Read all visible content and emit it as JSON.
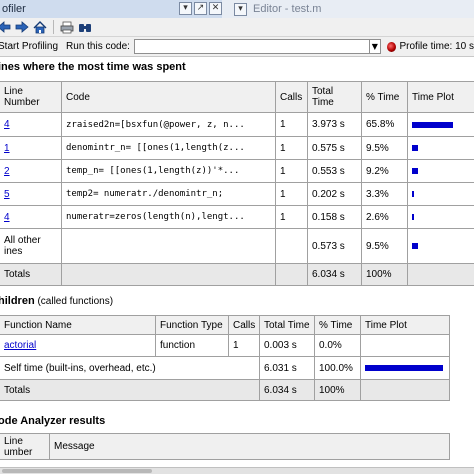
{
  "titlebar": {
    "profiler_tab": "ofiler",
    "editor_tab": "Editor - test.m"
  },
  "controls": {
    "start_profiling": "Start Profiling",
    "run_this_code": "Run this code:",
    "run_value": "",
    "profile_time": "Profile time: 10 s"
  },
  "lines_section": {
    "heading": "ines where the most time was spent",
    "headers": [
      "Line Number",
      "Code",
      "Calls",
      "Total Time",
      "% Time",
      "Time Plot"
    ],
    "rows": [
      {
        "line": "4",
        "code": "zraised2n=[bsxfun(@power, z, n...",
        "calls": "1",
        "total": "3.973 s",
        "pct": "65.8%",
        "frac": 0.658
      },
      {
        "line": "1",
        "code": "denomintr_n= [[ones(1,length(z...",
        "calls": "1",
        "total": "0.575 s",
        "pct": "9.5%",
        "frac": 0.095
      },
      {
        "line": "2",
        "code": "temp_n= [[ones(1,length(z))'*...",
        "calls": "1",
        "total": "0.553 s",
        "pct": "9.2%",
        "frac": 0.092
      },
      {
        "line": "5",
        "code": "temp2= numeratr./denomintr_n;",
        "calls": "1",
        "total": "0.202 s",
        "pct": "3.3%",
        "frac": 0.033
      },
      {
        "line": "4",
        "code": "numeratr=zeros(length(n),lengt...",
        "calls": "1",
        "total": "0.158 s",
        "pct": "2.6%",
        "frac": 0.026
      }
    ],
    "other": {
      "label_1": "All other",
      "label_2": "ines",
      "total": "0.573 s",
      "pct": "9.5%",
      "frac": 0.095
    },
    "totals": {
      "label": "Totals",
      "total": "6.034 s",
      "pct": "100%"
    }
  },
  "children_section": {
    "heading_bold": "hildren",
    "heading_rest": " (called functions)",
    "headers": [
      "Function Name",
      "Function Type",
      "Calls",
      "Total Time",
      "% Time",
      "Time Plot"
    ],
    "rows": [
      {
        "name": "actorial",
        "type": "function",
        "calls": "1",
        "total": "0.003 s",
        "pct": "0.0%",
        "frac": 0.0
      }
    ],
    "self_time": {
      "label": "Self time (built-ins, overhead, etc.)",
      "total": "6.031 s",
      "pct": "100.0%",
      "frac": 1.0
    },
    "totals": {
      "label": "Totals",
      "total": "6.034 s",
      "pct": "100%"
    }
  },
  "analyzer_section": {
    "heading": "ode Analyzer results",
    "headers": [
      "Line number",
      "Message"
    ],
    "header_line_1": "Line",
    "header_line_2": "umber"
  },
  "colors": {
    "bar": "#0000cc",
    "link": "#0000cc",
    "titlebar": "#cfdcee"
  },
  "icons": [
    "back-arrow-icon",
    "forward-arrow-icon",
    "home-icon",
    "print-icon",
    "find-icon",
    "dropdown-icon",
    "record-icon"
  ]
}
